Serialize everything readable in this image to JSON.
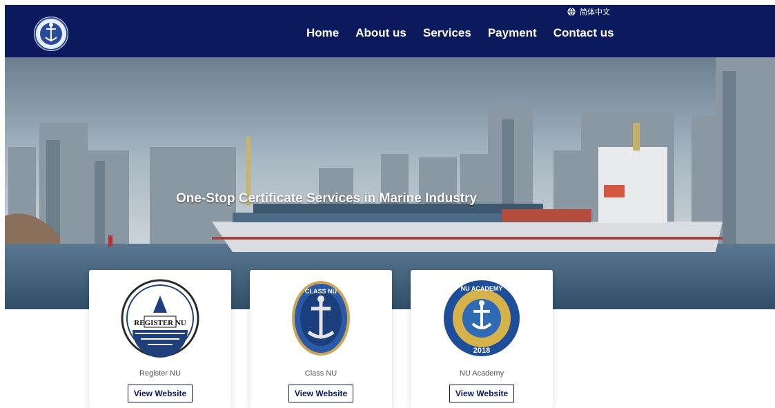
{
  "header": {
    "language_label": "简体中文",
    "nav": [
      "Home",
      "About us",
      "Services",
      "Payment",
      "Contact us"
    ],
    "colors": {
      "navy": "#0b1a5c",
      "text": "#ffffff"
    }
  },
  "hero": {
    "title": "One-Stop Certificate Services in Marine Industry"
  },
  "cards": [
    {
      "name": "Register NU",
      "button": "View Website",
      "emblem_text": "REGISTER NU"
    },
    {
      "name": "Class NU",
      "button": "View Website",
      "emblem_text": "CLASS NU"
    },
    {
      "name": "NU Academy",
      "button": "View Website",
      "emblem_text": "NU ACADEMY",
      "year": "2018"
    }
  ]
}
